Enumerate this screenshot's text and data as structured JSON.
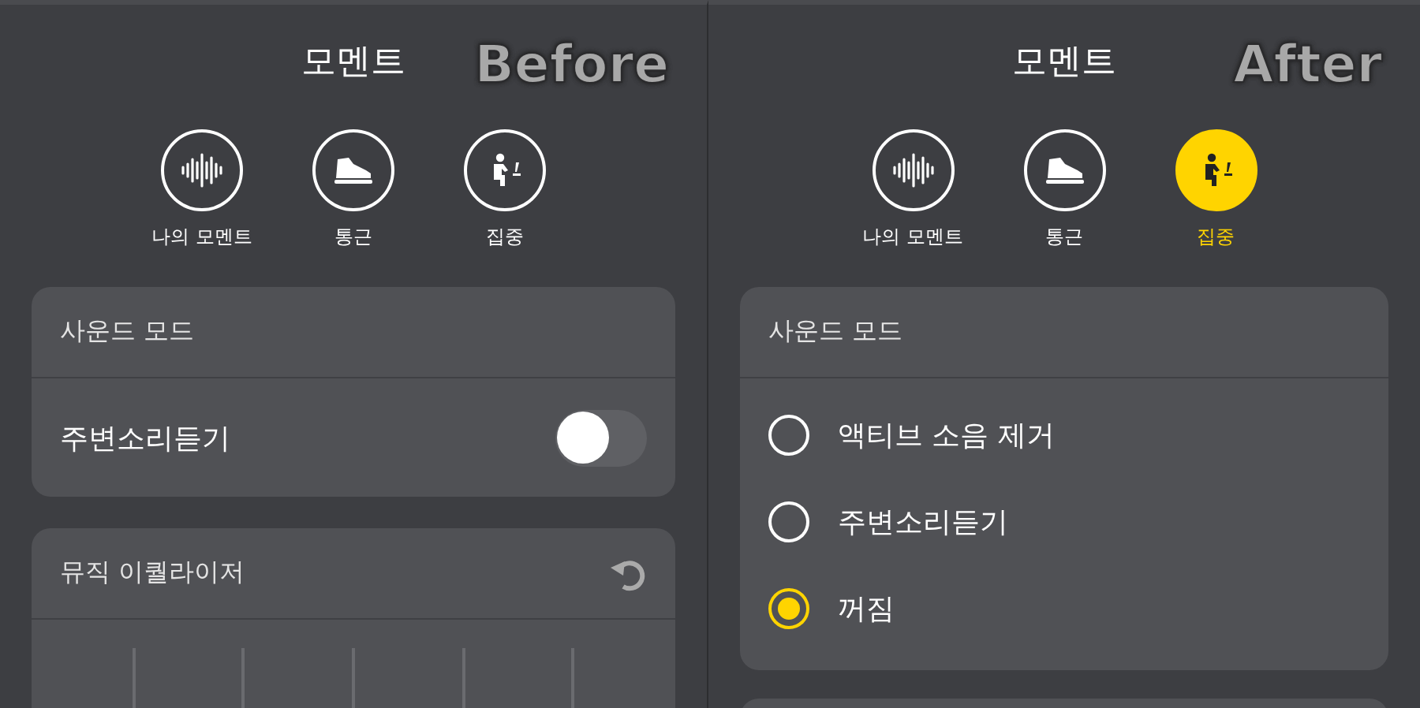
{
  "panels": [
    {
      "title": "모멘트",
      "badge": "Before",
      "modes": [
        {
          "kind": "wave",
          "label": "나의 모멘트",
          "selected": false
        },
        {
          "kind": "shoe",
          "label": "통근",
          "selected": false
        },
        {
          "kind": "desk",
          "label": "집중",
          "selected": false
        }
      ],
      "sound_mode": {
        "title": "사운드 모드",
        "rows": [
          {
            "kind": "toggle",
            "label": "주변소리듣기",
            "on": false
          }
        ]
      },
      "equalizer": {
        "title": "뮤직 이퀄라이저"
      }
    },
    {
      "title": "모멘트",
      "badge": "After",
      "modes": [
        {
          "kind": "wave",
          "label": "나의 모멘트",
          "selected": false
        },
        {
          "kind": "shoe",
          "label": "통근",
          "selected": false
        },
        {
          "kind": "desk",
          "label": "집중",
          "selected": true
        }
      ],
      "sound_mode": {
        "title": "사운드 모드",
        "rows": [
          {
            "kind": "radio",
            "label": "액티브 소음 제거",
            "selected": false
          },
          {
            "kind": "radio",
            "label": "주변소리듣기",
            "selected": false
          },
          {
            "kind": "radio",
            "label": "꺼짐",
            "selected": true
          }
        ]
      }
    }
  ]
}
